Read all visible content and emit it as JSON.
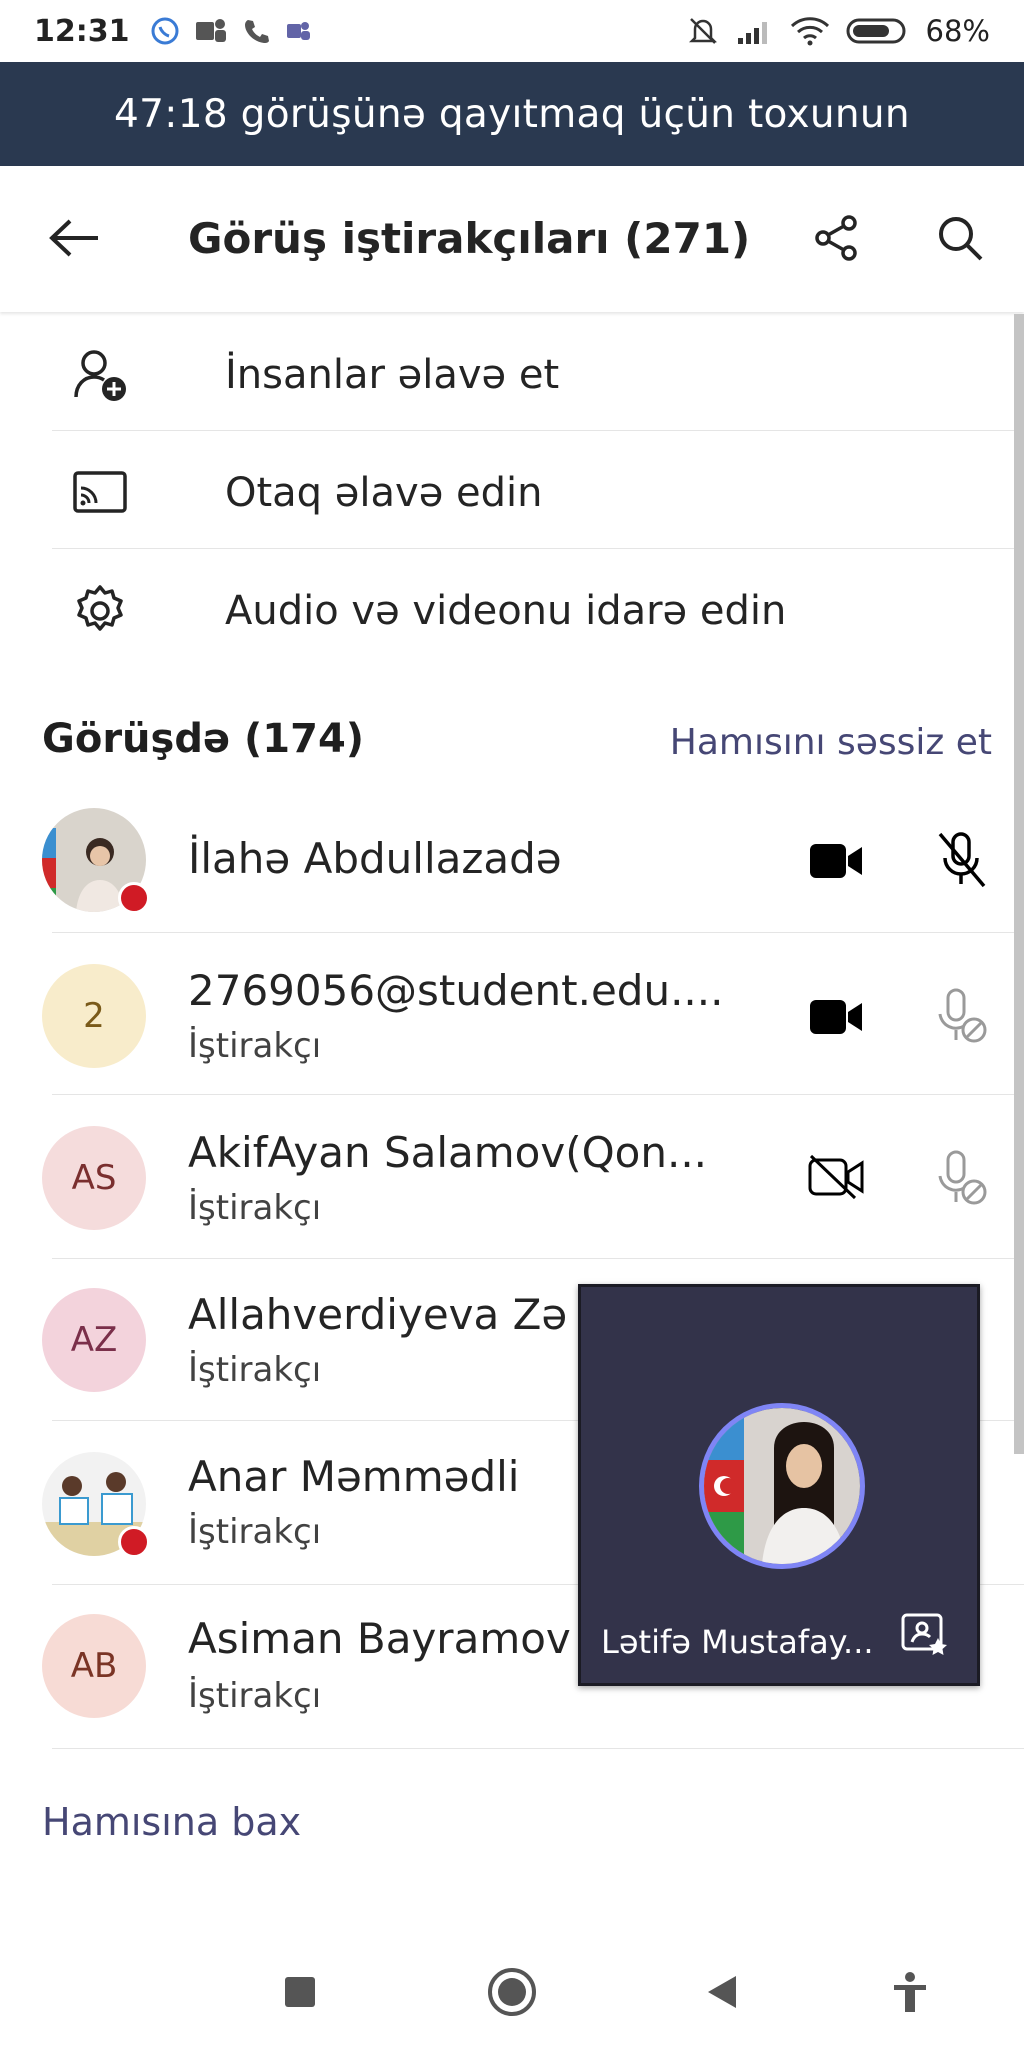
{
  "status_bar": {
    "time": "12:31",
    "battery": "68%"
  },
  "banner": {
    "text": "47:18 görüşünə qayıtmaq üçün toxunun"
  },
  "header": {
    "title": "Görüş iştirakçıları (271)"
  },
  "actions": [
    {
      "label": "İnsanlar əlavə et",
      "icon": "add-person-icon"
    },
    {
      "label": "Otaq əlavə edin",
      "icon": "cast-icon"
    },
    {
      "label": "Audio və videonu idarə edin",
      "icon": "gear-icon"
    }
  ],
  "section": {
    "title": "Görüşdə (174)",
    "mute_all": "Hamısını səssiz et"
  },
  "participants": [
    {
      "name": "İlahə Abdullazadə",
      "role": "",
      "initials": "",
      "video": "on",
      "mic": "muted",
      "recording": true
    },
    {
      "name": "2769056@student.edu....",
      "role": "İştirakçı",
      "initials": "2",
      "video": "on",
      "mic": "disabled",
      "recording": false
    },
    {
      "name": "AkifAyan Salamov(Qon...",
      "role": "İştirakçı",
      "initials": "AS",
      "video": "off",
      "mic": "disabled",
      "recording": false
    },
    {
      "name": "Allahverdiyeva Zə",
      "role": "İştirakçı",
      "initials": "AZ",
      "video": "",
      "mic": "",
      "recording": false
    },
    {
      "name": "Anar Məmmədli",
      "role": "İştirakçı",
      "initials": "",
      "video": "",
      "mic": "",
      "recording": true
    },
    {
      "name": "Asiman Bayramov",
      "role": "İştirakçı",
      "initials": "AB",
      "video": "",
      "mic": "",
      "recording": false
    }
  ],
  "see_all": "Hamısına bax",
  "pip": {
    "name": "Lətifə Mustafay..."
  },
  "colors": {
    "banner_bg": "#2a3950",
    "accent": "#464775",
    "pip_bg": "#33334a",
    "record": "#d01b25"
  }
}
